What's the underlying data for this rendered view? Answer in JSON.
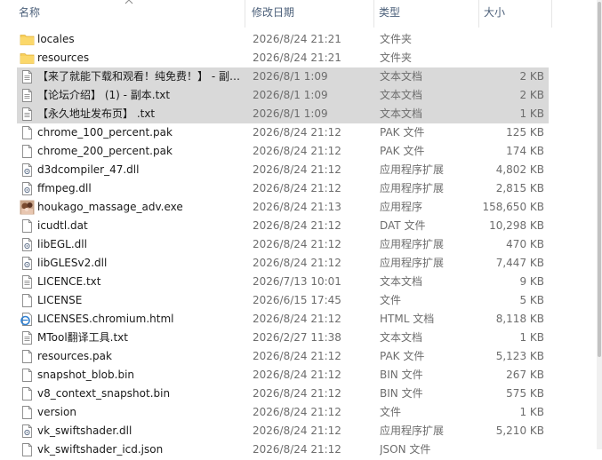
{
  "columns": {
    "name": "名称",
    "date": "修改日期",
    "type": "类型",
    "size": "大小"
  },
  "files": [
    {
      "name": "locales",
      "date": "2026/8/24 21:21",
      "type": "文件夹",
      "size": "",
      "icon": "folder-icon",
      "selected": false
    },
    {
      "name": "resources",
      "date": "2026/8/24 21:21",
      "type": "文件夹",
      "size": "",
      "icon": "folder-icon",
      "selected": false
    },
    {
      "name": "【来了就能下载和观看！纯免费！】 - 副本.txt",
      "date": "2026/8/1 1:09",
      "type": "文本文档",
      "size": "2 KB",
      "icon": "text-file-icon",
      "selected": true
    },
    {
      "name": "【论坛介绍】 (1) - 副本.txt",
      "date": "2026/8/1 1:09",
      "type": "文本文档",
      "size": "2 KB",
      "icon": "text-file-icon",
      "selected": true
    },
    {
      "name": "【永久地址发布页】 .txt",
      "date": "2026/8/1 1:09",
      "type": "文本文档",
      "size": "1 KB",
      "icon": "text-file-icon",
      "selected": true
    },
    {
      "name": "chrome_100_percent.pak",
      "date": "2026/8/24 21:12",
      "type": "PAK 文件",
      "size": "125 KB",
      "icon": "file-icon",
      "selected": false
    },
    {
      "name": "chrome_200_percent.pak",
      "date": "2026/8/24 21:12",
      "type": "PAK 文件",
      "size": "174 KB",
      "icon": "file-icon",
      "selected": false
    },
    {
      "name": "d3dcompiler_47.dll",
      "date": "2026/8/24 21:12",
      "type": "应用程序扩展",
      "size": "4,802 KB",
      "icon": "dll-icon",
      "selected": false
    },
    {
      "name": "ffmpeg.dll",
      "date": "2026/8/24 21:12",
      "type": "应用程序扩展",
      "size": "2,815 KB",
      "icon": "dll-icon",
      "selected": false
    },
    {
      "name": "houkago_massage_adv.exe",
      "date": "2026/8/24 21:13",
      "type": "应用程序",
      "size": "158,650 KB",
      "icon": "exe-icon",
      "selected": false
    },
    {
      "name": "icudtl.dat",
      "date": "2026/8/24 21:12",
      "type": "DAT 文件",
      "size": "10,298 KB",
      "icon": "file-icon",
      "selected": false
    },
    {
      "name": "libEGL.dll",
      "date": "2026/8/24 21:12",
      "type": "应用程序扩展",
      "size": "470 KB",
      "icon": "dll-icon",
      "selected": false
    },
    {
      "name": "libGLESv2.dll",
      "date": "2026/8/24 21:12",
      "type": "应用程序扩展",
      "size": "7,447 KB",
      "icon": "dll-icon",
      "selected": false
    },
    {
      "name": "LICENCE.txt",
      "date": "2026/7/13 10:01",
      "type": "文本文档",
      "size": "9 KB",
      "icon": "text-file-icon",
      "selected": false
    },
    {
      "name": "LICENSE",
      "date": "2026/6/15 17:45",
      "type": "文件",
      "size": "5 KB",
      "icon": "file-icon",
      "selected": false
    },
    {
      "name": "LICENSES.chromium.html",
      "date": "2026/8/24 21:12",
      "type": "HTML 文档",
      "size": "8,118 KB",
      "icon": "html-icon",
      "selected": false
    },
    {
      "name": "MTool翻译工具.txt",
      "date": "2026/2/27 11:38",
      "type": "文本文档",
      "size": "1 KB",
      "icon": "text-file-icon",
      "selected": false
    },
    {
      "name": "resources.pak",
      "date": "2026/8/24 21:12",
      "type": "PAK 文件",
      "size": "5,123 KB",
      "icon": "file-icon",
      "selected": false
    },
    {
      "name": "snapshot_blob.bin",
      "date": "2026/8/24 21:12",
      "type": "BIN 文件",
      "size": "267 KB",
      "icon": "file-icon",
      "selected": false
    },
    {
      "name": "v8_context_snapshot.bin",
      "date": "2026/8/24 21:12",
      "type": "BIN 文件",
      "size": "575 KB",
      "icon": "file-icon",
      "selected": false
    },
    {
      "name": "version",
      "date": "2026/8/24 21:12",
      "type": "文件",
      "size": "1 KB",
      "icon": "file-icon",
      "selected": false
    },
    {
      "name": "vk_swiftshader.dll",
      "date": "2026/8/24 21:12",
      "type": "应用程序扩展",
      "size": "5,210 KB",
      "icon": "dll-icon",
      "selected": false
    },
    {
      "name": "vk_swiftshader_icd.json",
      "date": "2026/8/24 21:12",
      "type": "JSON 文件",
      "size": "",
      "icon": "file-icon",
      "selected": false
    }
  ],
  "colors": {
    "selection": "#d9d9d9",
    "header_text": "#4c607a",
    "folder": "#f8cf5a"
  }
}
